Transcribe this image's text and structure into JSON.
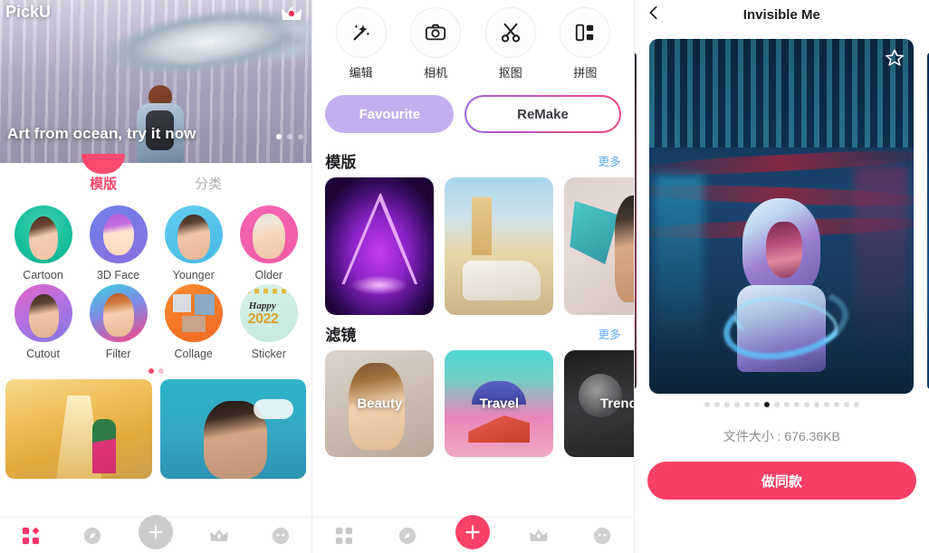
{
  "panel1": {
    "app_name": "PickU",
    "crown_icon": "crown-premium-icon",
    "banner": {
      "title": "Art from ocean, try it now",
      "dots": 3,
      "active_dot": 0
    },
    "tabs": [
      {
        "label": "模版",
        "active": true
      },
      {
        "label": "分类",
        "active": false
      }
    ],
    "features": [
      {
        "label": "Cartoon",
        "style": "c-cartoon"
      },
      {
        "label": "3D Face",
        "style": "c-3dface"
      },
      {
        "label": "Younger",
        "style": "c-younger"
      },
      {
        "label": "Older",
        "style": "c-older"
      },
      {
        "label": "Cutout",
        "style": "c-cutout"
      },
      {
        "label": "Filter",
        "style": "c-filter"
      },
      {
        "label": "Collage",
        "style": "c-collage"
      },
      {
        "label": "Sticker",
        "style": "c-sticker"
      }
    ],
    "sticker_card": {
      "happy_text": "Happy",
      "year_text": "2022"
    },
    "grid_dots": 2,
    "grid_active_dot": 0,
    "cards": [
      {
        "name": "temple-stairs-template"
      },
      {
        "name": "cartoon-portrait-template"
      }
    ],
    "bottomnav": [
      {
        "name": "nav-templates",
        "icon": "grid-icon",
        "active": true
      },
      {
        "name": "nav-discover",
        "icon": "compass-icon",
        "active": false
      },
      {
        "name": "nav-create",
        "icon": "plus-icon",
        "active": false,
        "style": "plus-gray"
      },
      {
        "name": "nav-premium",
        "icon": "crown-icon",
        "active": false
      },
      {
        "name": "nav-profile",
        "icon": "smiley-icon",
        "active": false
      }
    ]
  },
  "panel2": {
    "tools": [
      {
        "label": "编辑",
        "icon": "magic-wand-icon"
      },
      {
        "label": "相机",
        "icon": "camera-icon"
      },
      {
        "label": "抠图",
        "icon": "scissors-icon"
      },
      {
        "label": "拼图",
        "icon": "collage-grid-icon"
      }
    ],
    "buttons": {
      "favourite": "Favourite",
      "remake": "ReMake"
    },
    "sections": [
      {
        "title": "模版",
        "more": "更多",
        "cards": [
          {
            "name": "neon-triangle-template",
            "style": "t1",
            "label": ""
          },
          {
            "name": "vintage-car-template",
            "style": "t2",
            "label": ""
          },
          {
            "name": "splash-portrait-template",
            "style": "t3",
            "label": ""
          }
        ]
      },
      {
        "title": "滤镜",
        "more": "更多",
        "cards": [
          {
            "name": "beauty-filter",
            "style": "f1",
            "label": "Beauty"
          },
          {
            "name": "travel-filter",
            "style": "f2",
            "label": "Travel"
          },
          {
            "name": "trend-filter",
            "style": "f3",
            "label": "Trend"
          }
        ]
      }
    ],
    "bottomnav": [
      {
        "name": "nav-templates",
        "icon": "grid-icon",
        "active": false
      },
      {
        "name": "nav-discover",
        "icon": "compass-icon",
        "active": false
      },
      {
        "name": "nav-create",
        "icon": "plus-icon",
        "active": true,
        "style": "plus-pink"
      },
      {
        "name": "nav-premium",
        "icon": "crown-icon",
        "active": false
      },
      {
        "name": "nav-profile",
        "icon": "smiley-icon",
        "active": false
      }
    ]
  },
  "panel3": {
    "back_icon": "chevron-left-icon",
    "title": "Invisible Me",
    "favorite_icon": "star-outline-icon",
    "preview": {
      "name": "cyberpunk-hooded-figure-preview"
    },
    "dots": 16,
    "active_dot": 6,
    "file_size_label": "文件大小 : 676.36KB",
    "cta_label": "做同款"
  },
  "colors": {
    "accent_pink": "#fa4a6e",
    "cta_pink": "#fa3f66",
    "favourite_purple": "#c3aff0",
    "more_blue": "#5aa9ef"
  }
}
